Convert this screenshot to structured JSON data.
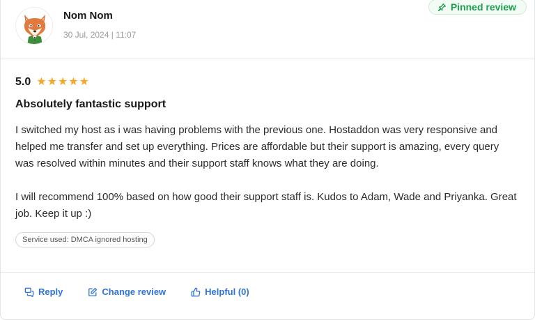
{
  "pinned_label": "Pinned review",
  "reviewer": {
    "name": "Nom Nom",
    "date": "30 Jul, 2024 | 11:07"
  },
  "review": {
    "rating": "5.0",
    "stars": 5,
    "title": "Absolutely fantastic support",
    "paragraphs": [
      "I switched my host as i was having problems with the previous one. Hostaddon was very responsive and helped me transfer and set up everything. Prices are affordable but their support is amazing, every query was resolved within minutes and their support staff knows what they are doing.",
      "I will recommend 100% based on how good their support staff is. Kudos to Adam, Wade and Priyanka. Great job. Keep it up :)"
    ],
    "service_tag": "Service used: DMCA ignored hosting"
  },
  "actions": {
    "reply": "Reply",
    "change_review": "Change review",
    "helpful": "Helpful (0)"
  },
  "colors": {
    "star": "#f7a826",
    "link": "#2f73d9",
    "pinned": "#1e9e4f"
  }
}
